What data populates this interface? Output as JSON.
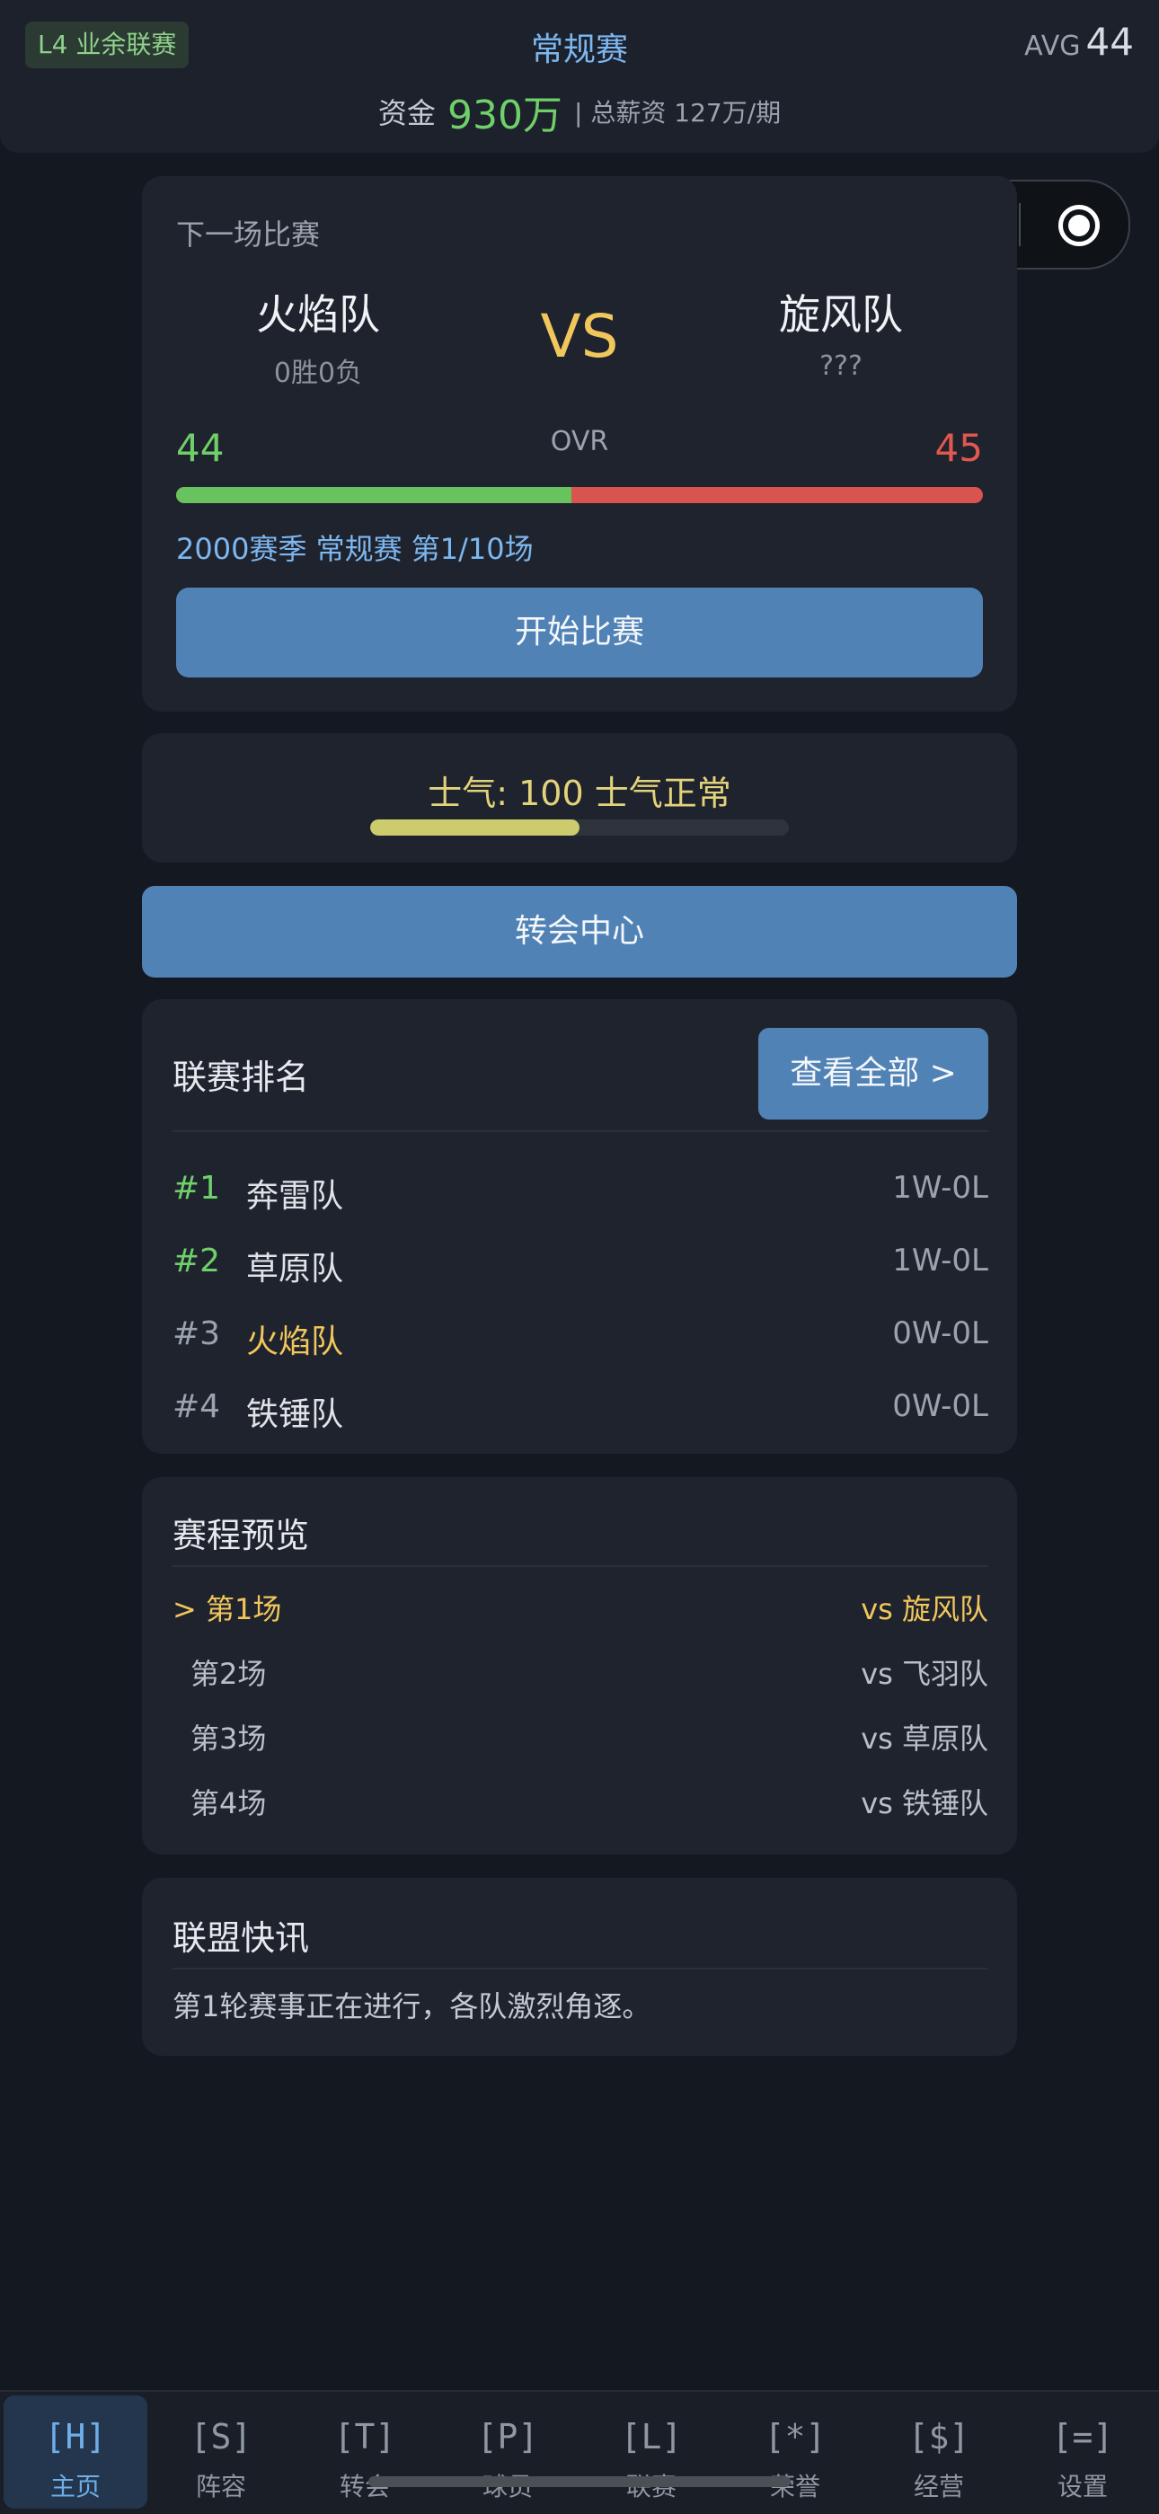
{
  "header": {
    "league_badge": "L4 业余联赛",
    "phase": "常规赛",
    "avg_label": "AVG",
    "avg_value": "44",
    "money_label": "资金",
    "money_value": "930万",
    "salary": "| 总薪资 127万/期"
  },
  "next_match": {
    "title": "下一场比赛",
    "home_name": "火焰队",
    "home_record": "0胜0负",
    "vs": "VS",
    "away_name": "旋风队",
    "away_record": "???",
    "home_ovr": "44",
    "ovr_label": "OVR",
    "away_ovr": "45",
    "ovr_home_share": 0.49,
    "season_info": "2000赛季 常规赛 第1/10场",
    "start_button": "开始比赛"
  },
  "morale": {
    "text": "士气: 100 士气正常",
    "level": 0.5
  },
  "transfer_button": "转会中心",
  "standings": {
    "title": "联赛排名",
    "view_all": "查看全部 >",
    "rows": [
      {
        "pos": "#1",
        "name": "奔雷队",
        "record": "1W-0L"
      },
      {
        "pos": "#2",
        "name": "草原队",
        "record": "1W-0L"
      },
      {
        "pos": "#3",
        "name": "火焰队",
        "record": "0W-0L"
      },
      {
        "pos": "#4",
        "name": "铁锤队",
        "record": "0W-0L"
      }
    ]
  },
  "schedule": {
    "title": "赛程预览",
    "rows": [
      {
        "round": "> 第1场",
        "opponent": "vs 旋风队"
      },
      {
        "round": "第2场",
        "opponent": "vs 飞羽队"
      },
      {
        "round": "第3场",
        "opponent": "vs 草原队"
      },
      {
        "round": "第4场",
        "opponent": "vs 铁锤队"
      }
    ]
  },
  "news": {
    "title": "联盟快讯",
    "text": "第1轮赛事正在进行，各队激烈角逐。"
  },
  "tabs": [
    {
      "icon": "[H]",
      "label": "主页"
    },
    {
      "icon": "[S]",
      "label": "阵容"
    },
    {
      "icon": "[T]",
      "label": "转会"
    },
    {
      "icon": "[P]",
      "label": "球员"
    },
    {
      "icon": "[L]",
      "label": "联赛"
    },
    {
      "icon": "[*]",
      "label": "荣誉"
    },
    {
      "icon": "[$]",
      "label": "经营"
    },
    {
      "icon": "[=]",
      "label": "设置"
    }
  ],
  "colors": {
    "accent_blue": "#5182b6",
    "highlight_gold": "#f1c65c",
    "positive_green": "#6fd06a",
    "negative_red": "#d9534f"
  }
}
